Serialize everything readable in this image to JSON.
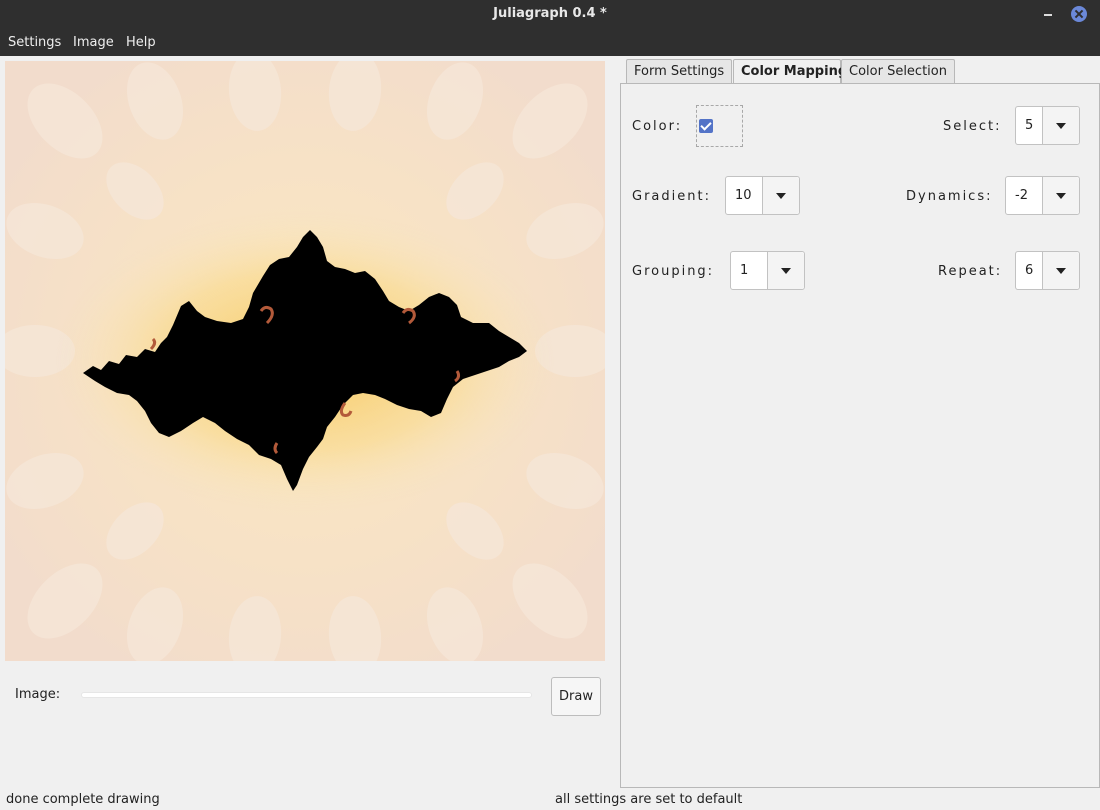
{
  "window": {
    "title": "Juliagraph 0.4 *"
  },
  "menu": {
    "settings": "Settings",
    "image": "Image",
    "help": "Help"
  },
  "canvas": {
    "icon": "fractal-image"
  },
  "bottom": {
    "image_label": "Image:",
    "progress": 0,
    "draw_label": "Draw"
  },
  "tabs": {
    "form_settings": "Form Settings",
    "color_mapping": "Color Mapping",
    "color_selection": "Color Selection"
  },
  "fields": {
    "color_label": "Color:",
    "color_checked": true,
    "select_label": "Select:",
    "select_value": "5",
    "gradient_label": "Gradient:",
    "gradient_value": "10",
    "dynamics_label": "Dynamics:",
    "dynamics_value": "-2",
    "grouping_label": "Grouping:",
    "grouping_value": "1",
    "repeat_label": "Repeat:",
    "repeat_value": "6"
  },
  "status": {
    "left": "done complete drawing",
    "right": "all settings are set to default"
  },
  "colors": {
    "accent": "#5373c7",
    "titlebar": "#2f2f2f",
    "canvas_bg": "#f3ddc8",
    "fractal": "#000000",
    "glow": "#f7c450"
  }
}
